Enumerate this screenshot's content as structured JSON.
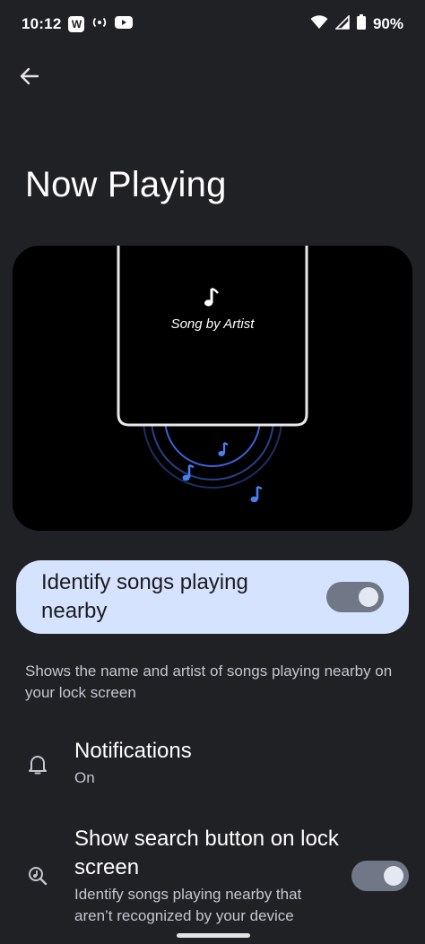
{
  "status_bar": {
    "time": "10:12",
    "w_badge": "W",
    "battery_text": "90%",
    "left_icons": [
      "w-app-icon",
      "hotspot-icon",
      "youtube-icon"
    ],
    "right_icons": [
      "wifi-icon",
      "signal-icon",
      "battery-icon"
    ]
  },
  "header": {
    "back_icon": "arrow-left-icon",
    "title": "Now Playing"
  },
  "illustration": {
    "song_text": "Song by Artist",
    "icons": [
      "music-note-icon"
    ]
  },
  "main_toggle": {
    "label": "Identify songs playing nearby",
    "state": "on"
  },
  "description": "Shows the name and artist of songs playing nearby on your lock screen",
  "settings": [
    {
      "icon": "bell-icon",
      "title": "Notifications",
      "subtitle": "On"
    },
    {
      "icon": "music-search-icon",
      "title": "Show search button on lock screen",
      "subtitle": "Identify songs playing nearby that aren’t recognized by your device",
      "toggle_state": "on"
    }
  ],
  "colors": {
    "background": "#202124",
    "card_background": "#d5e3ff",
    "switch_track": "#707787",
    "accent_note": "#4a7df0"
  }
}
